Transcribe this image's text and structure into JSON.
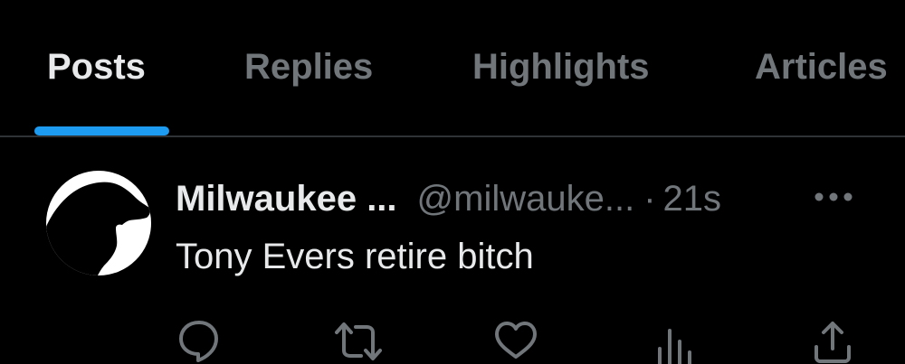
{
  "tabs": {
    "posts": "Posts",
    "replies": "Replies",
    "highlights": "Highlights",
    "articles": "Articles",
    "active": "posts",
    "accent_color": "#1d9bf0"
  },
  "post": {
    "display_name": "Milwaukee ...",
    "handle": "@milwauke...",
    "separator": "·",
    "time": "21s",
    "text": "Tony Evers retire bitch",
    "avatar_icon": "dog-silhouette-icon"
  },
  "actions": {
    "reply_icon": "reply-icon",
    "repost_icon": "repost-icon",
    "like_icon": "like-icon",
    "views_icon": "views-icon",
    "share_icon": "share-icon",
    "more_icon": "more-icon"
  },
  "colors": {
    "background": "#000000",
    "primary_text": "#e7e9ea",
    "secondary_text": "#71767b",
    "divider": "#2f3336"
  }
}
